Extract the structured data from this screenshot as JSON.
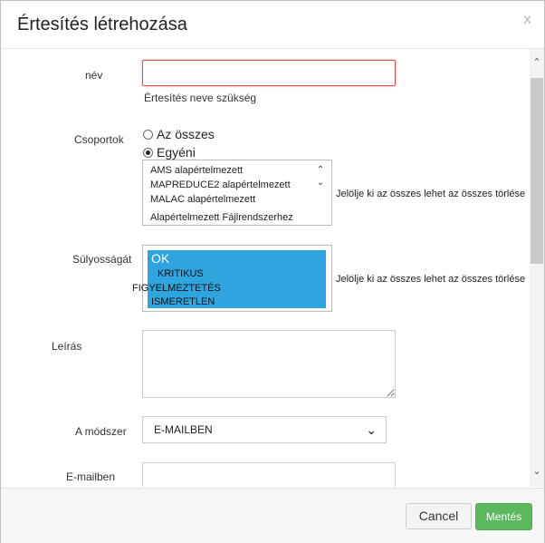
{
  "dialog": {
    "title": "Értesítés létrehozása",
    "close_glyph": "x"
  },
  "form": {
    "name": {
      "label": "név",
      "value": "",
      "error": "Értesítés neve szükség"
    },
    "groups": {
      "label": "Csoportok",
      "option_all": "Az összes",
      "option_custom": "Egyéni",
      "selected_option": "Egyéni",
      "items": [
        "AMS alapértelmezett",
        "MAPREDUCE2 alapértelmezett",
        "MALAC alapértelmezett",
        "Alapértelmezett Fájlrendszerhez"
      ],
      "links": "Jelölje ki az összes lehet az összes törlése"
    },
    "severity": {
      "label": "Súlyosságát",
      "items": [
        "OK",
        "KRITIKUS",
        "FIGYELMEZTETÉS",
        "ISMERETLEN"
      ],
      "links": "Jelölje ki az összes lehet az összes törlése"
    },
    "description": {
      "label": "Leírás",
      "value": ""
    },
    "method": {
      "label": "A módszer",
      "value": "E-MAILBEN"
    },
    "email": {
      "label": "E-mailben",
      "value": ""
    }
  },
  "footer": {
    "cancel_label": "Cancel",
    "save_label": "Mentés"
  },
  "colors": {
    "selection": "#2fa5df",
    "save_button": "#5cb85c",
    "error_border": "#d9534f"
  }
}
